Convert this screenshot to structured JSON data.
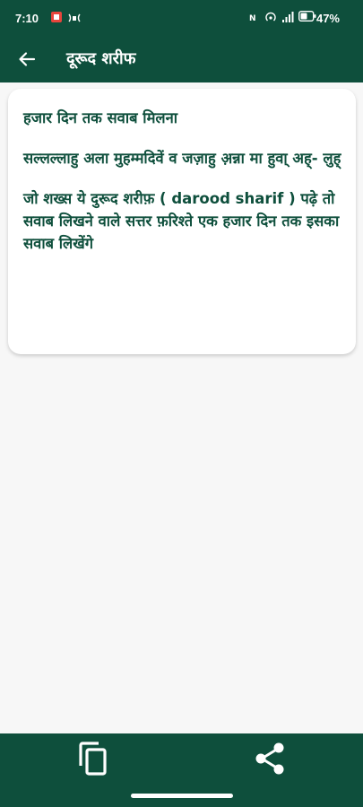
{
  "status_bar": {
    "time": "7:10",
    "battery_percent": "47%",
    "icons": [
      "notification-app-icon",
      "cast-icon",
      "hotspot-icon",
      "wifi-icon",
      "signal-icon",
      "battery-icon"
    ]
  },
  "app_bar": {
    "title": "दूरूद शरीफ",
    "back_icon": "arrow-left-icon"
  },
  "card": {
    "paragraphs": [
      "हजार दिन तक सवाब मिलना",
      "सल्लल्लाहु अला मुहम्मदिवें व जज़ाहु अ़न्ना मा हुवा् अह्- लुह्",
      "जो शख्स ये दुरूद शरीफ़ ( darood sharif ) पढ़े तो सवाब लिखने वाले सत्तर फ़रिश्ते एक हजार दिन तक इसका सवाब लिखेंगे"
    ]
  },
  "bottom_bar": {
    "icons": [
      "copy-icon",
      "share-icon"
    ]
  },
  "colors": {
    "primary": "#0e4f3c",
    "background": "#f7f7f7",
    "card": "#ffffff",
    "text": "#0e4f3c"
  }
}
